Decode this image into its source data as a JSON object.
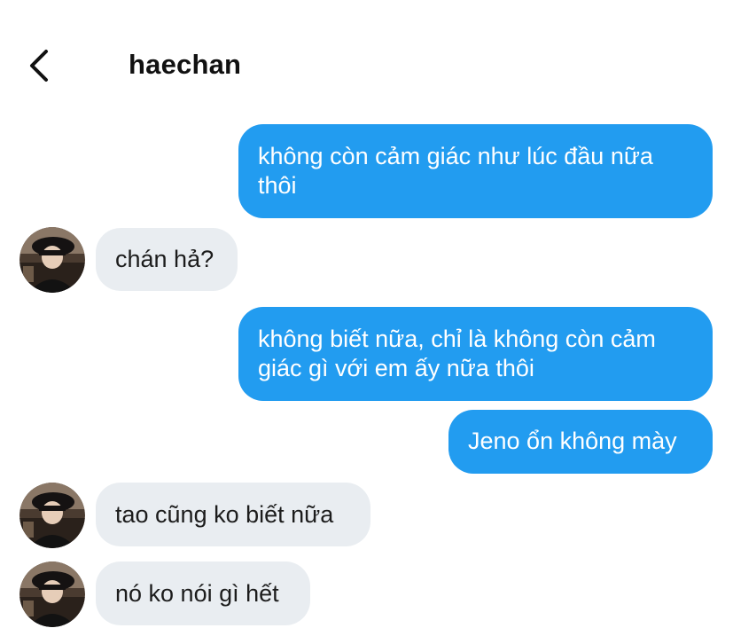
{
  "header": {
    "back_icon": "chevron-left-icon",
    "title": "haechan"
  },
  "contact": {
    "avatar_icon": "avatar-photo"
  },
  "messages": [
    {
      "sender": "me",
      "text": "không còn cảm giác như lúc đầu nữa thôi"
    },
    {
      "sender": "haechan",
      "text": "chán hả?"
    },
    {
      "sender": "me",
      "text": "không biết nữa, chỉ là không còn cảm giác gì với em ấy nữa thôi"
    },
    {
      "sender": "me",
      "text": "Jeno ổn không mày"
    },
    {
      "sender": "haechan",
      "text": "tao cũng ko biết nữa"
    },
    {
      "sender": "haechan",
      "text": "nó ko nói gì hết"
    }
  ],
  "colors": {
    "outgoing_bubble": "#229cf0",
    "incoming_bubble": "#e9edf1",
    "outgoing_text": "#ffffff",
    "incoming_text": "#1c1c1c"
  }
}
